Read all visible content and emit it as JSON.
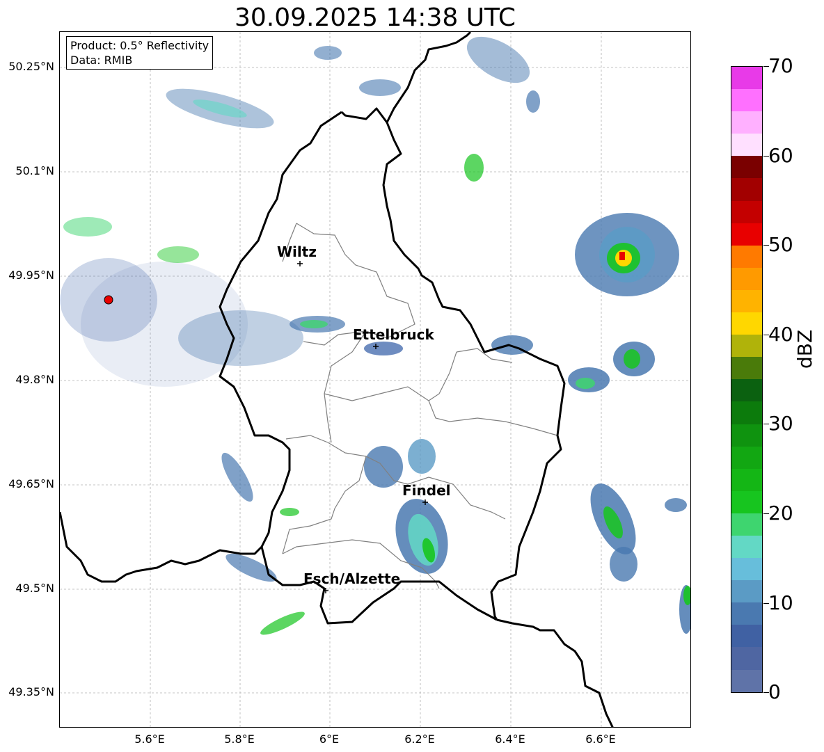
{
  "title": "30.09.2025 14:38 UTC",
  "info": {
    "product": "Product: 0.5° Reflectivity",
    "data": "Data: RMIB"
  },
  "latitude_labels": [
    "50.25°N",
    "50.1°N",
    "49.95°N",
    "49.8°N",
    "49.65°N",
    "49.5°N",
    "49.35°N"
  ],
  "longitude_labels": [
    "5.6°E",
    "5.8°E",
    "6°E",
    "6.2°E",
    "6.4°E",
    "6.6°E"
  ],
  "cities": [
    "Wiltz",
    "Ettelbruck",
    "Findel",
    "Esch/Alzette"
  ],
  "colorbar": {
    "label": "dBZ",
    "ticks": [
      "0",
      "10",
      "20",
      "30",
      "40",
      "50",
      "60",
      "70"
    ],
    "colors": [
      "#5f73a8",
      "#4f66a2",
      "#4061a3",
      "#4a79b0",
      "#5b9bc5",
      "#67bedb",
      "#63d8c5",
      "#3ed56f",
      "#17c51f",
      "#14b615",
      "#12a712",
      "#0f930f",
      "#0c7b0c",
      "#0b6110",
      "#4a7b0a",
      "#b0b30a",
      "#ffd700",
      "#ffb300",
      "#ff9a00",
      "#ff7a00",
      "#e80000",
      "#c40000",
      "#a20000",
      "#7a0000",
      "#ffe0ff",
      "#ffb0ff",
      "#ff70ff",
      "#e83ae8"
    ]
  }
}
